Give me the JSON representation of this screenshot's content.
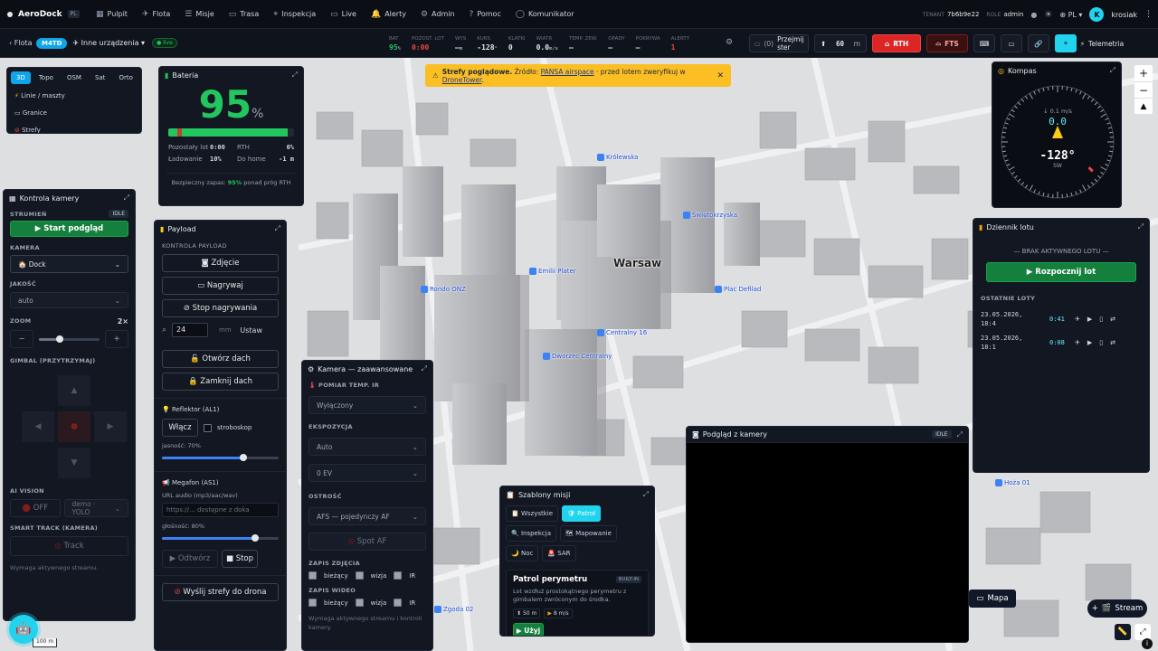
{
  "app": {
    "name": "AeroDock",
    "lang_badge": "PL"
  },
  "nav": [
    {
      "label": "Pulpit",
      "icon": "grid-icon"
    },
    {
      "label": "Flota",
      "icon": "plane-icon"
    },
    {
      "label": "Misje",
      "icon": "list-icon"
    },
    {
      "label": "Trasa",
      "icon": "map-icon"
    },
    {
      "label": "Inspekcja",
      "icon": "crosshair-icon"
    },
    {
      "label": "Live",
      "icon": "video-icon"
    },
    {
      "label": "Alerty",
      "icon": "bell-icon"
    },
    {
      "label": "Admin",
      "icon": "gear-icon"
    },
    {
      "label": "Pomoc",
      "icon": "help-icon"
    },
    {
      "label": "Komunikator",
      "icon": "chat-icon"
    }
  ],
  "topbar": {
    "tenant_label": "TENANT",
    "tenant": "7b6b9e22",
    "role_label": "ROLE",
    "role": "admin",
    "lang": "PL",
    "avatar_letter": "K",
    "user": "krosiak"
  },
  "telebar": {
    "back": "Flota",
    "model": "M4TD",
    "device_select": "Inne urządzenia",
    "live": "live",
    "stats": [
      {
        "label": "BAT",
        "value": "95",
        "unit": "%",
        "color": "green"
      },
      {
        "label": "POZOST. LOT",
        "value": "0:00",
        "color": "red"
      },
      {
        "label": "WYS",
        "value": "—",
        "unit": "m"
      },
      {
        "label": "KURS",
        "value": "-128",
        "unit": "°"
      },
      {
        "label": "KLATKI",
        "value": "0"
      },
      {
        "label": "WIATR",
        "value": "0.0",
        "unit": "m/s"
      },
      {
        "label": "TEMP. ZEW.",
        "value": "—"
      },
      {
        "label": "OPADY",
        "value": "—"
      },
      {
        "label": "POKRYWA",
        "value": "—"
      },
      {
        "label": "ALERTY",
        "value": "1",
        "color": "red"
      }
    ],
    "takeover_count": "(0)",
    "takeover": "Przejmij ster",
    "alt_value": "60",
    "alt_unit": "m",
    "rth": "RTH",
    "fts": "FTS",
    "telemetry": "Telemetria"
  },
  "banner": {
    "bold": "Strefy poglądowe.",
    "text1": " Źródło: ",
    "link1": "PANSA airspace",
    "text2": " · przed lotem zweryfikuj w ",
    "link2": "DroneTower",
    "text3": "."
  },
  "map_layers": {
    "tabs": [
      "3D",
      "Topo",
      "OSM",
      "Sat",
      "Orto"
    ],
    "active": "3D",
    "items": [
      "Linie / maszty",
      "Granice",
      "Strefy"
    ]
  },
  "battery": {
    "title": "Bateria",
    "percent": "95",
    "unit": "%",
    "level": 95,
    "rows": [
      {
        "l": "Pozostały lot",
        "v": "0:00",
        "l2": "RTH",
        "v2": "0%"
      },
      {
        "l": "Ładowanie",
        "v": "10%",
        "l2": "Do home",
        "v2": "-1 m"
      }
    ],
    "footer_a": "Bezpieczny zapas: ",
    "footer_b": "95%",
    "footer_c": " ponad próg RTH"
  },
  "camera_ctrl": {
    "title": "Kontrola kamery",
    "stream_label": "STRUMIEŃ",
    "stream_state": "IDLE",
    "start": "Start podgląd",
    "camera_label": "KAMERA",
    "camera_value": "Dock",
    "quality_label": "JAKOŚĆ",
    "quality_value": "auto",
    "zoom_label": "ZOOM",
    "zoom_value": "2×",
    "zoom_level": 0.35,
    "gimbal_label": "GIMBAL (PRZYTRZYMAJ)",
    "ai_label": "AI VISION",
    "ai_off": "OFF",
    "ai_model": "demo · YOLO",
    "smart_label": "SMART TRACK (KAMERA)",
    "track": "Track",
    "hint": "Wymaga aktywnego streamu."
  },
  "payload": {
    "title": "Payload",
    "section": "KONTROLA PAYLOAD",
    "photo": "Zdjęcie",
    "record": "Nagrywaj",
    "stop_rec": "Stop nagrywania",
    "zoom_value": "24",
    "zoom_unit": "mm",
    "set": "Ustaw",
    "open_roof": "Otwórz dach",
    "close_roof": "Zamknij dach",
    "reflector": "Reflektor (AL1)",
    "toggle": "Włącz",
    "strobe": "stroboskop",
    "brightness": "jasność: 70%",
    "brightness_level": 0.7,
    "megaphone": "Megafon (AS1)",
    "url_label": "URL audio (mp3/aac/wav)",
    "url_placeholder": "https://... dostępne z doka",
    "volume": "głośność: 80%",
    "volume_level": 0.8,
    "play": "Odtwórz",
    "stop": "Stop",
    "send_zones": "Wyślij strefy do drona"
  },
  "cam_adv": {
    "title": "Kamera — zaawansowane",
    "ir_label": "POMIAR TEMP. IR",
    "ir_value": "Wyłączony",
    "exp_label": "EKSPOZYCJA",
    "exp_value": "Auto",
    "ev_value": "0 EV",
    "focus_label": "OSTROŚĆ",
    "focus_value": "AFS — pojedynczy AF",
    "spot": "Spot AF",
    "photo_label": "ZAPIS ZDJĘCIA",
    "video_label": "ZAPIS WIDEO",
    "opts": [
      "bieżący",
      "wizja",
      "IR"
    ],
    "hint": "Wymaga aktywnego streamu i kontroli kamery."
  },
  "templates": {
    "title": "Szablony misji",
    "filters": [
      "Wszystkie",
      "Patrol",
      "Inspekcja",
      "Mapowanie",
      "Noc",
      "SAR"
    ],
    "active": "Patrol",
    "card_title": "Patrol perymetru",
    "card_badge": "BUILT-IN",
    "card_desc": "Lot wzdłuż prostokątnego perymetru z gimbalem zwróconym do środka.",
    "alt": "50 m",
    "speed": "8 m/s",
    "use": "Użyj"
  },
  "preview": {
    "title": "Podgląd z kamery",
    "state": "IDLE"
  },
  "compass": {
    "title": "Kompas",
    "vs": "↓ 0.1 m/s",
    "speed": "0.0",
    "speed_unit": "m/s",
    "heading": "-128°",
    "dir": "SW"
  },
  "flightlog": {
    "title": "Dziennik lotu",
    "none": "— BRAK AKTYWNEGO LOTU —",
    "start": "Rozpocznij lot",
    "recent": "OSTATNIE LOTY",
    "items": [
      {
        "date": "23.05.2026,",
        "time": "18:4",
        "dur": "0:41"
      },
      {
        "date": "23.05.2026,",
        "time": "18:1",
        "dur": "0:08"
      }
    ]
  },
  "map": {
    "city": "Warsaw",
    "labels": [
      "Centralny 16",
      "Dworzec Centralny",
      "Emilii Plater",
      "Plac Defilad",
      "Królewska",
      "Świętokrzyska",
      "Rondo ONZ",
      "Hoża 01",
      "Zgoda 02"
    ],
    "mapa_btn": "Mapa",
    "stream_btn": "Stream",
    "scale": "100 m"
  }
}
